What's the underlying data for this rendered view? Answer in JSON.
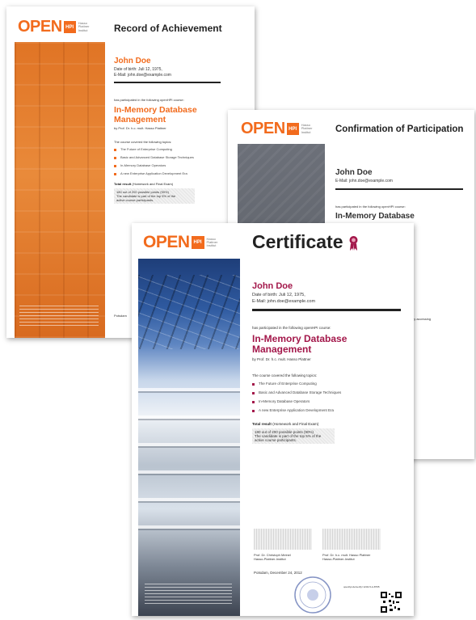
{
  "brand": {
    "open": "OPEN",
    "box": "HPI",
    "institute": [
      "Hasso",
      "Plattner",
      "Institut"
    ]
  },
  "back": {
    "title": "Record of Achievement",
    "name": "John Doe",
    "dob": "Date of birth: Juli 12, 1975,",
    "email": "E-Mail: john.doe@example.com",
    "participated": "has participated in the following openHPI course:",
    "course": [
      "In-Memory Database",
      "Management"
    ],
    "prof": "by Prof. Dr. h.c. mult. Hasso Plattner",
    "covered": "The course covered the following topics:",
    "topics": [
      "The Future of Enterprise Computing",
      "Basic and Advanced Database Storage Techniques",
      "In-Memory Database Operators",
      "A new Enterprise Application Development Era"
    ],
    "total_label": "Total result",
    "total_sub": "(Homework and Final Exam)",
    "result": "180 out of 200 possible points (90%)",
    "result2": "The candidate is part of the top 5% of the",
    "result3": "active course participants.",
    "potsdam": "Potsdam"
  },
  "middle": {
    "title": "Confirmation of Participation",
    "name": "John Doe",
    "email": "E-Mail: john.doe@example.com",
    "participated": "has participated in the following openHPI course:",
    "course": "In-Memory Database",
    "accessing": "by accessing"
  },
  "front": {
    "title": "Certificate",
    "name": "John Doe",
    "dob": "Date of birth: Juli 12, 1975,",
    "email": "E-Mail: john.doe@example.com",
    "participated": "has participated in the following openHPI course:",
    "course": [
      "In-Memory Database",
      "Management"
    ],
    "prof": "by Prof. Dr. h.c. mult. Hasso Plattner",
    "covered": "The course covered the following topics:",
    "topics": [
      "The Future of Enterprise Computing",
      "Basic and Advanced Database Storage Techniques",
      "In-Memory Database Operators",
      "A new Enterprise Application Development Era"
    ],
    "total_label": "Total result",
    "total_sub": "(Homework and Final Exam)",
    "result": "180 out of 200 possible points (90%)",
    "result2": "The candidate is part of the top 5% of the",
    "result3": "active course participants.",
    "sig1": "Prof. Dr. Christoph Meinel",
    "sig1b": "Hasso-Plattner-Institut",
    "sig2": "Prof. Dr. h.c. mult. Hasso Plattner",
    "sig2b": "Hasso-Plattner-Institut",
    "date": "Potsdam, December 24, 2012",
    "verify": "openhpi.de/verify/ 1234-5-A-8765"
  },
  "colors": {
    "orange": "#f26b1d",
    "crimson": "#a3174a",
    "front_accent": "#a3174a"
  }
}
